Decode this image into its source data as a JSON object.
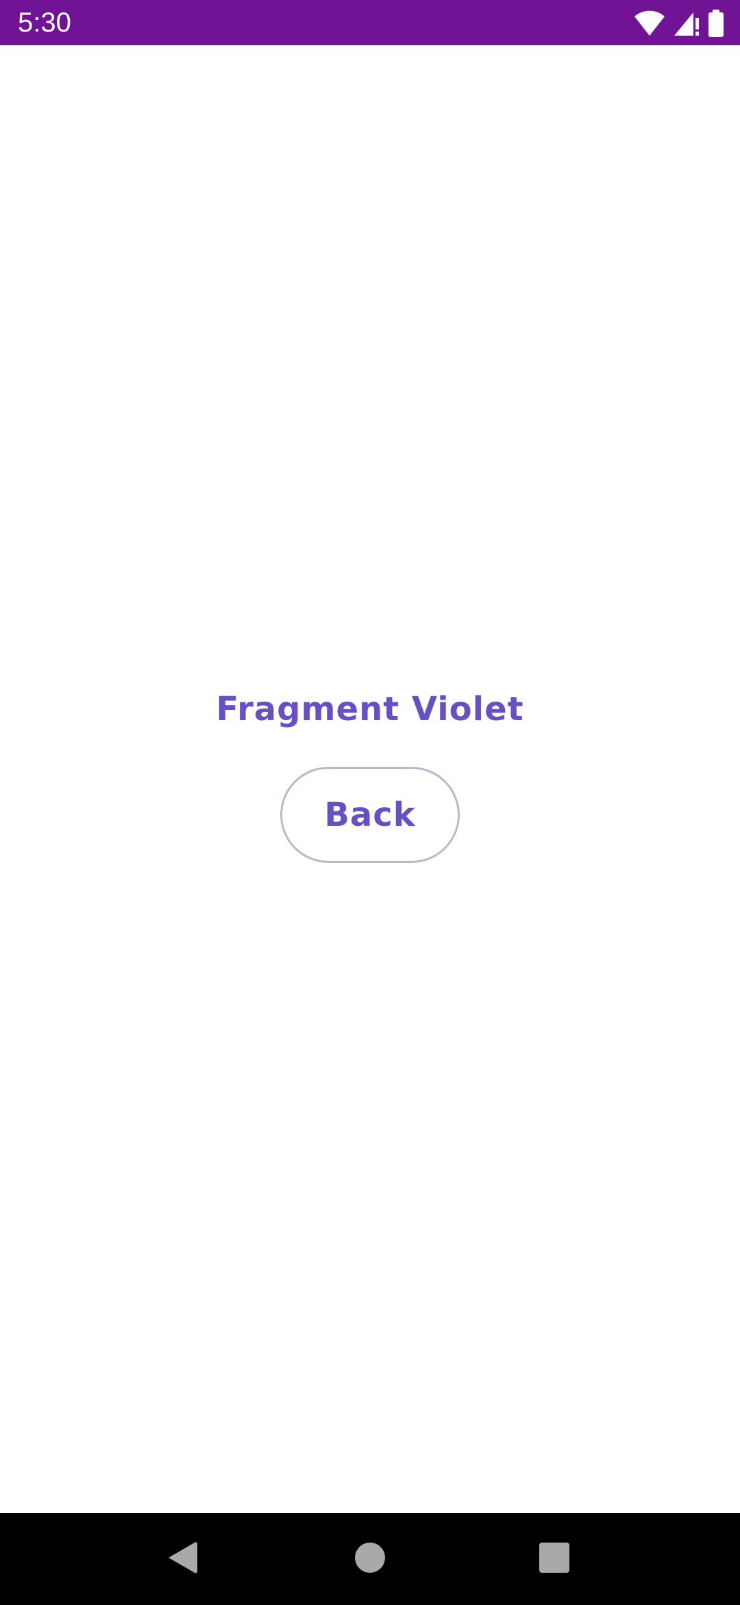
{
  "status_bar": {
    "time": "5:30",
    "background_color": "#701394",
    "icons": [
      "wifi-icon",
      "cell-signal-icon",
      "battery-icon"
    ]
  },
  "fragment": {
    "title": "Fragment Violet",
    "accent_color": "#6650c4"
  },
  "back_button": {
    "label": "Back",
    "border_color": "#b3bccb"
  },
  "nav_bar": {
    "buttons": [
      "nav-back-icon",
      "nav-home-icon",
      "nav-recents-icon"
    ]
  }
}
